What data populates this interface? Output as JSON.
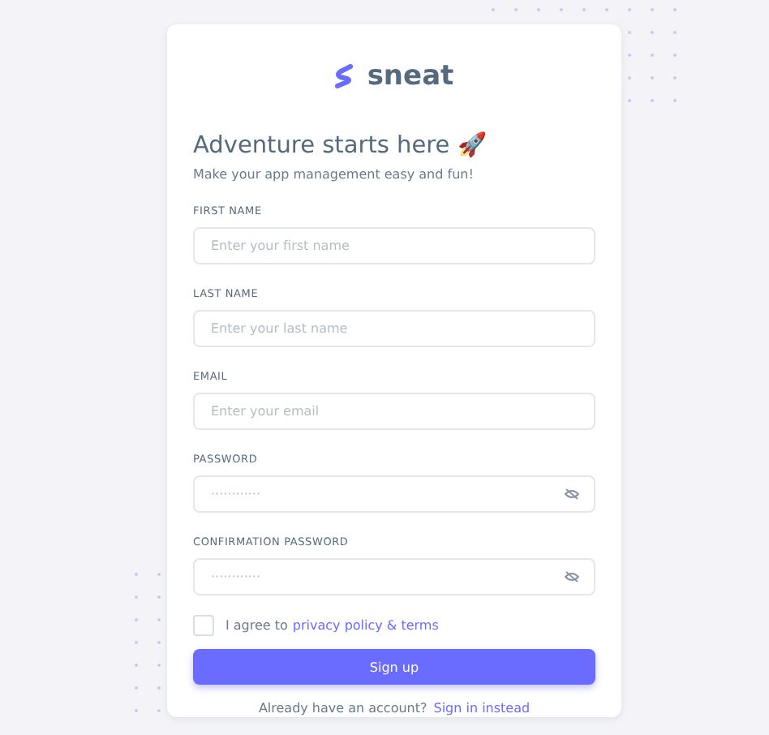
{
  "brand": {
    "name": "sneat"
  },
  "heading": "Adventure starts here 🚀",
  "subheading": "Make your app management easy and fun!",
  "fields": [
    {
      "label": "FIRST NAME",
      "placeholder": "Enter your first name",
      "kind": "text"
    },
    {
      "label": "LAST NAME",
      "placeholder": "Enter your last name",
      "kind": "text"
    },
    {
      "label": "EMAIL",
      "placeholder": "Enter your email",
      "kind": "text"
    },
    {
      "label": "PASSWORD",
      "placeholder": "············",
      "kind": "password"
    },
    {
      "label": "CONFIRMATION PASSWORD",
      "placeholder": "············",
      "kind": "password"
    }
  ],
  "agree": {
    "text": "I agree to",
    "link": "privacy policy & terms",
    "checked": false
  },
  "submit": "Sign up",
  "footer": {
    "text": "Already have an account?",
    "link": "Sign in instead"
  }
}
